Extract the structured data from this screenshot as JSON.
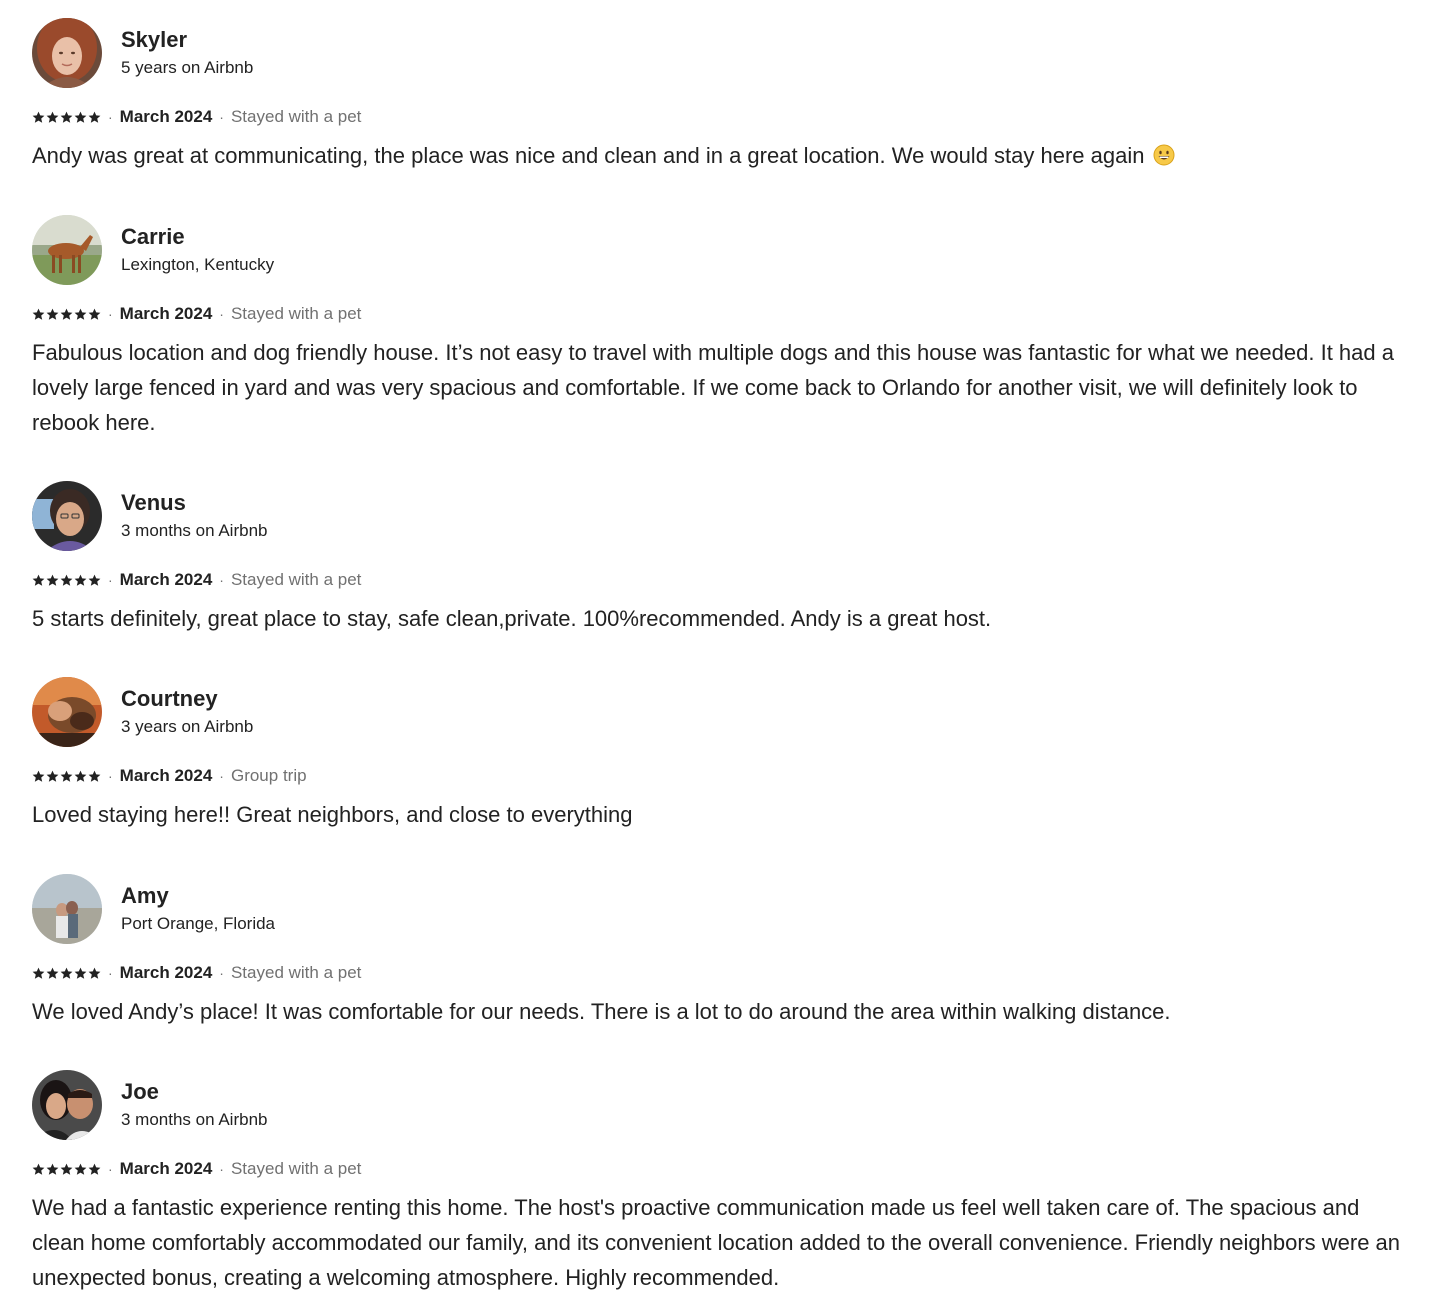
{
  "colors": {
    "text": "#222222",
    "muted": "#717171",
    "star": "#222222"
  },
  "reviews": [
    {
      "name": "Skyler",
      "subtitle": "5 years on Airbnb",
      "rating": 5,
      "date": "March 2024",
      "trip": "Stayed with a pet",
      "text": "Andy was great at communicating, the place was nice and clean and in a great location. We would stay here again",
      "emoji": "grinning-face-emoji"
    },
    {
      "name": "Carrie",
      "subtitle": "Lexington, Kentucky",
      "rating": 5,
      "date": "March 2024",
      "trip": "Stayed with a pet",
      "text": "Fabulous location and dog friendly house. It’s not easy to travel with multiple dogs and this house was fantastic for what we needed. It had a lovely large fenced in yard and was very spacious and comfortable. If we come back to Orlando for another visit, we will definitely look to rebook here."
    },
    {
      "name": "Venus",
      "subtitle": "3 months on Airbnb",
      "rating": 5,
      "date": "March 2024",
      "trip": "Stayed with a pet",
      "text": "5 starts definitely, great place to stay, safe clean,private. 100%recommended. Andy is a great host."
    },
    {
      "name": "Courtney",
      "subtitle": "3 years on Airbnb",
      "rating": 5,
      "date": "March 2024",
      "trip": "Group trip",
      "text": "Loved staying here!! Great neighbors, and close to everything"
    },
    {
      "name": "Amy",
      "subtitle": "Port Orange, Florida",
      "rating": 5,
      "date": "March 2024",
      "trip": "Stayed with a pet",
      "text": "We loved Andy’s place! It was comfortable for our needs. There is a lot to do around the area within walking distance."
    },
    {
      "name": "Joe",
      "subtitle": "3 months on Airbnb",
      "rating": 5,
      "date": "March 2024",
      "trip": "Stayed with a pet",
      "text": "We had a fantastic experience renting this home. The host's proactive communication made us feel well taken care of. The spacious and clean home comfortably accommodated our family, and its convenient location added to the overall convenience. Friendly neighbors were an unexpected bonus, creating a welcoming atmosphere. Highly recommended."
    }
  ]
}
